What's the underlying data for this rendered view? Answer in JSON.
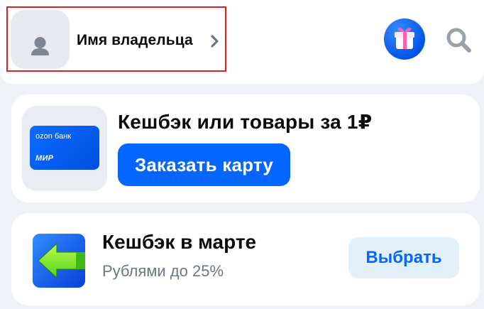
{
  "header": {
    "owner_name": "Имя владельца",
    "icons": [
      "avatar-icon",
      "chevron-right-icon",
      "gift-icon",
      "search-icon"
    ]
  },
  "card_offer": {
    "bank_card_brand": "ozon банк",
    "bank_card_system": "МИР",
    "title": "Кешбэк или товары за 1₽",
    "button_label": "Заказать карту"
  },
  "cashback": {
    "title": "Кешбэк в марте",
    "subtitle": "Рублями до 25%",
    "button_label": "Выбрать"
  },
  "colors": {
    "accent": "#0566ff",
    "highlight_border": "#e11d1d",
    "background": "#eef1f6",
    "light_button": "#e1f0fb"
  }
}
